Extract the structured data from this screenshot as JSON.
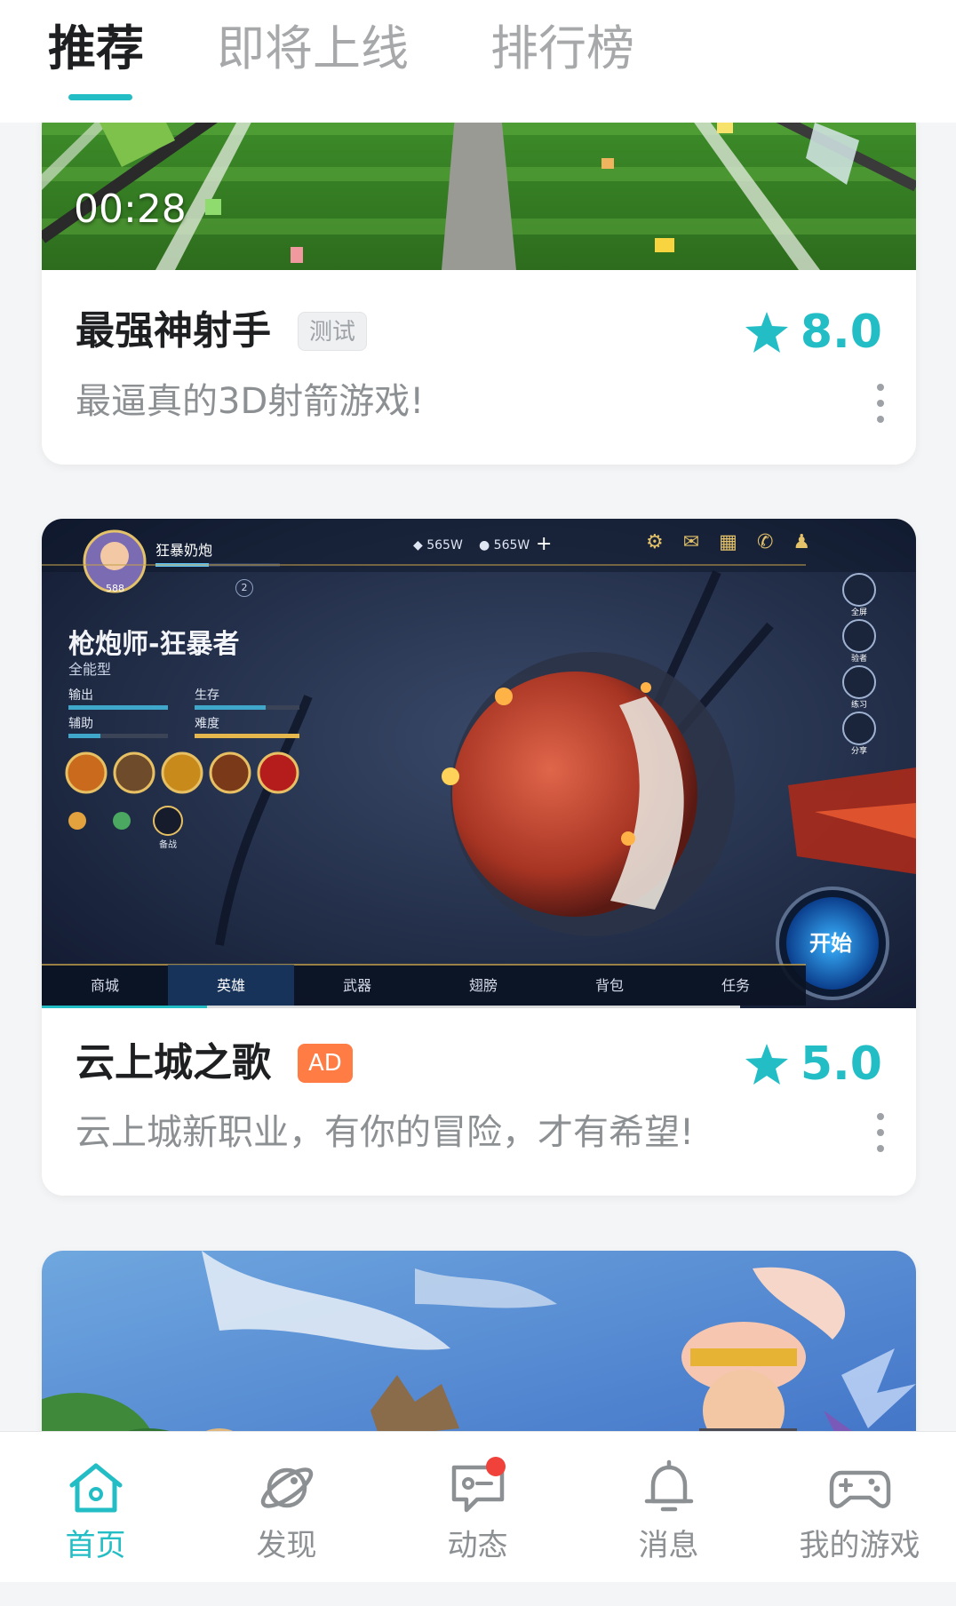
{
  "tabs": [
    {
      "label": "推荐",
      "active": true
    },
    {
      "label": "即将上线",
      "active": false
    },
    {
      "label": "排行榜",
      "active": false
    }
  ],
  "cards": [
    {
      "video_time": "00:28",
      "title": "最强神射手",
      "badge": "测试",
      "rating": "8.0",
      "description": "最逼真的3D射箭游戏!"
    },
    {
      "title": "云上城之歌",
      "badge": "AD",
      "rating": "5.0",
      "description": "云上城新职业，有你的冒险，才有希望!",
      "hud": {
        "player_name": "狂暴奶炮",
        "level": "588",
        "currency_1": "565W",
        "currency_2": "565W",
        "class_title": "枪炮师-狂暴者",
        "class_type": "全能型",
        "stats": [
          "输出",
          "生存",
          "辅助",
          "难度"
        ],
        "side_buttons": [
          "全屏",
          "验者",
          "练习",
          "分享"
        ],
        "skill_label": "备战",
        "start_button": "开始",
        "bottom_menu": [
          "商城",
          "英雄",
          "武器",
          "翅膀",
          "背包",
          "任务"
        ],
        "badge_count": "2"
      }
    },
    {}
  ],
  "bottom_nav": [
    {
      "label": "首页",
      "icon": "home-icon",
      "active": true
    },
    {
      "label": "发现",
      "icon": "planet-icon",
      "active": false
    },
    {
      "label": "动态",
      "icon": "chat-icon",
      "active": false,
      "dot": true
    },
    {
      "label": "消息",
      "icon": "bell-icon",
      "active": false
    },
    {
      "label": "我的游戏",
      "icon": "gamepad-icon",
      "active": false
    }
  ],
  "colors": {
    "accent": "#23bdc5",
    "ad_badge": "#ff7d45",
    "notification_dot": "#f0413a"
  }
}
